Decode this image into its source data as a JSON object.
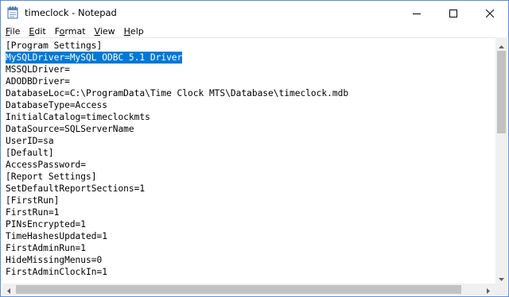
{
  "window": {
    "title": "timeclock - Notepad",
    "app_icon": "notepad-icon",
    "controls": [
      "minimize-icon",
      "maximize-icon",
      "close-icon"
    ]
  },
  "menu": [
    {
      "label": "File",
      "accel": "F",
      "rest": "ile"
    },
    {
      "label": "Edit",
      "accel": "E",
      "rest": "dit"
    },
    {
      "label": "Format",
      "accel": "F",
      "rest": "ormat"
    },
    {
      "label": "View",
      "accel": "V",
      "rest": "iew"
    },
    {
      "label": "Help",
      "accel": "H",
      "rest": "elp"
    }
  ],
  "editor": {
    "selected_line": 1,
    "lines": [
      "[Program Settings]",
      "MySQLDriver=MySQL ODBC 5.1 Driver",
      "MSSQLDriver=",
      "ADODBDriver=",
      "DatabaseLoc=C:\\ProgramData\\Time Clock MTS\\Database\\timeclock.mdb",
      "DatabaseType=Access",
      "InitialCatalog=timeclockmts",
      "DataSource=SQLServerName",
      "UserID=sa",
      "[Default]",
      "AccessPassword=",
      "[Report Settings]",
      "SetDefaultReportSections=1",
      "[FirstRun]",
      "FirstRun=1",
      "PINsEncrypted=1",
      "TimeHashesUpdated=1",
      "FirstAdminRun=1",
      "HideMissingMenus=0",
      "FirstAdminClockIn=1"
    ]
  },
  "colors": {
    "selection": "#0078d7",
    "window_border": "#5a8ed6",
    "scroll_track": "#f0f0f0",
    "scroll_thumb": "#c2c2c2"
  }
}
